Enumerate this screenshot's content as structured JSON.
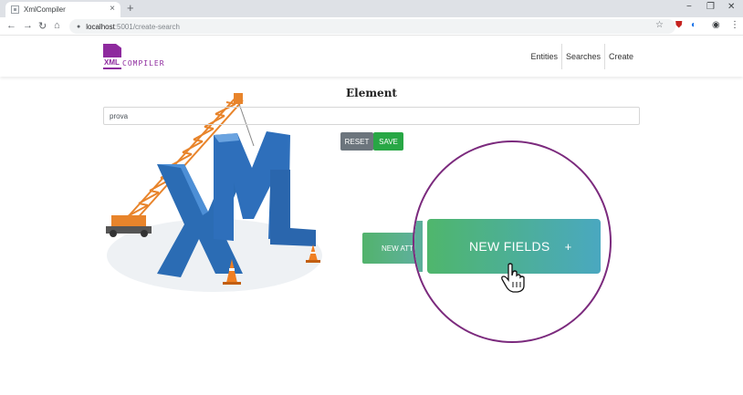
{
  "browser": {
    "tab_title": "XmlCompiler",
    "tab_close": "×",
    "new_tab": "+",
    "url_host": "localhost",
    "url_path": ":5001/create-search",
    "window_controls": [
      "−",
      "❐",
      "✕"
    ]
  },
  "navbar": {
    "logo_xml": "XML",
    "logo_compiler": "COMPILER",
    "menu": [
      "Entities",
      "Searches",
      "Create"
    ]
  },
  "page": {
    "title": "Element",
    "input_value": "prova",
    "reset_label": "RESET",
    "save_label": "SAVE",
    "new_att_label": "NEW ATT",
    "new_fields_label": "NEW FIELDS",
    "new_fields_plus": "+"
  },
  "hero_image": {
    "letters": [
      "X",
      "M",
      "L"
    ]
  },
  "colors": {
    "brand": "#8e2a9e",
    "reset": "#6c757d",
    "save": "#28a745",
    "gradient_start": "#4fb66c",
    "gradient_end": "#4aa8c0",
    "zoom_border": "#7b2a7d"
  }
}
